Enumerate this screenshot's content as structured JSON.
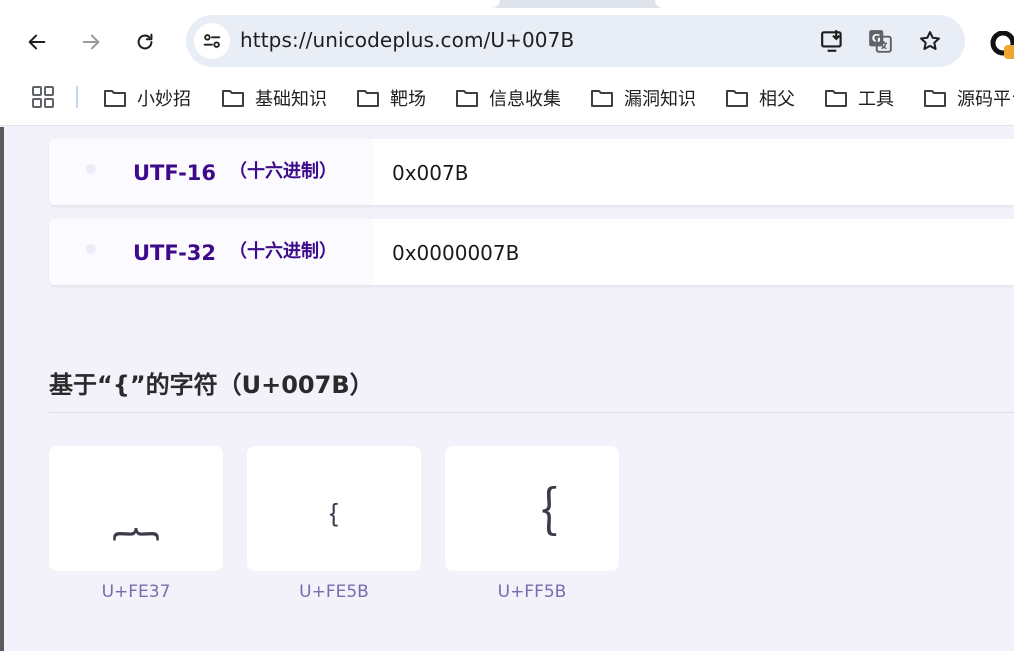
{
  "browser": {
    "url": "https://unicodeplus.com/U+007B",
    "icons": [
      "back-icon",
      "forward-icon",
      "reload-icon",
      "site-info-icon",
      "install-app-icon",
      "translate-icon",
      "bookmark-star-icon",
      "profile-icon"
    ]
  },
  "bookmarks": [
    {
      "label": "小妙招"
    },
    {
      "label": "基础知识"
    },
    {
      "label": "靶场"
    },
    {
      "label": "信息收集"
    },
    {
      "label": "漏洞知识"
    },
    {
      "label": "相父"
    },
    {
      "label": "工具"
    },
    {
      "label": "源码平台"
    }
  ],
  "encodings": [
    {
      "name": "UTF-16",
      "hint": "（十六进制）",
      "value": "0x007B"
    },
    {
      "name": "UTF-32",
      "hint": "（十六进制）",
      "value": "0x0000007B"
    }
  ],
  "related": {
    "title": "基于“{”的字符（U+007B）",
    "chars": [
      {
        "glyph": "︷",
        "code": "U+FE37"
      },
      {
        "glyph": "﹛",
        "code": "U+FE5B"
      },
      {
        "glyph": "｛",
        "code": "U+FF5B"
      }
    ]
  },
  "colors": {
    "accent": "#3d0a8a",
    "page_bg": "#f3f1fa",
    "code_text": "#7a6cae"
  }
}
